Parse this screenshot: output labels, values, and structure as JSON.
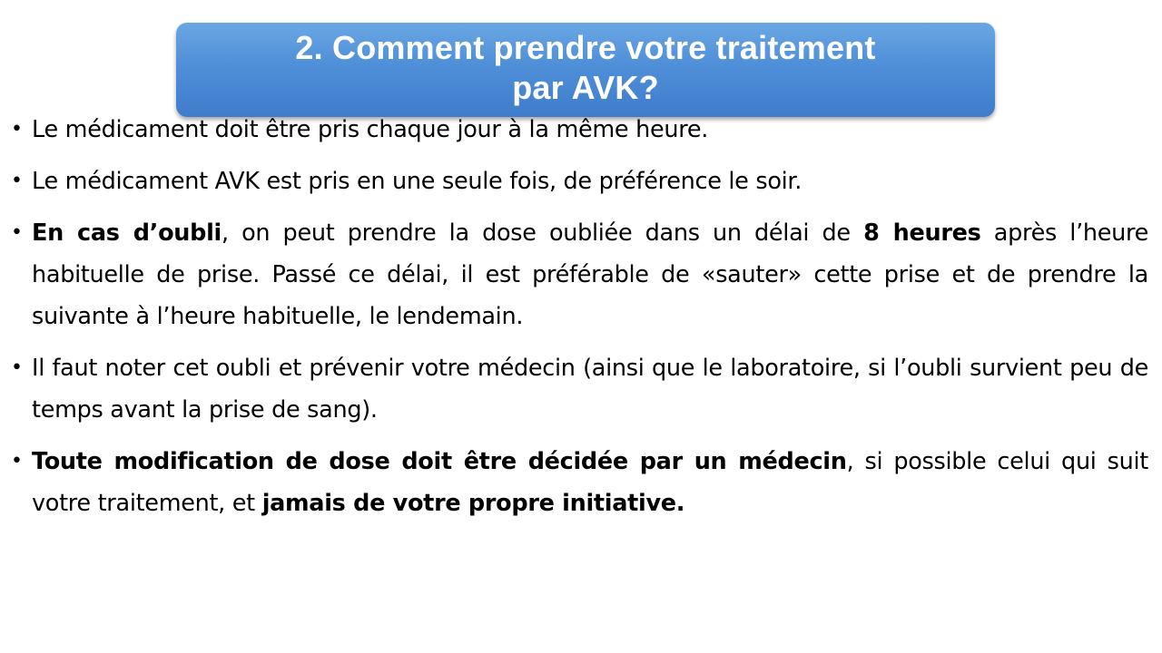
{
  "title": {
    "line1": "2. Comment prendre votre traitement",
    "line2": "par AVK?"
  },
  "bullet_glyph": "•",
  "bullets": {
    "b1": {
      "text": "Le médicament doit être pris chaque jour à la même heure."
    },
    "b2": {
      "text": "Le médicament AVK est pris en une seule fois, de préférence le soir."
    },
    "b3": {
      "bold1": "En cas d’oubli",
      "text1": ", on peut prendre la dose oubliée dans un délai de ",
      "bold2": "8 heures",
      "text2": " après l’heure habituelle de prise. Passé ce délai, il est préférable de «sauter» cette prise et de prendre la suivante à l’heure habituelle,  le lendemain."
    },
    "b4": {
      "text": "Il faut noter cet oubli et prévenir votre médecin (ainsi que le laboratoire, si l’oubli survient peu de temps avant la prise de sang)."
    },
    "b5": {
      "bold1": "Toute modification de dose doit être décidée par un médecin",
      "text1": ", si possible celui qui suit votre traitement, et ",
      "bold2": "jamais de votre propre initiative."
    }
  }
}
